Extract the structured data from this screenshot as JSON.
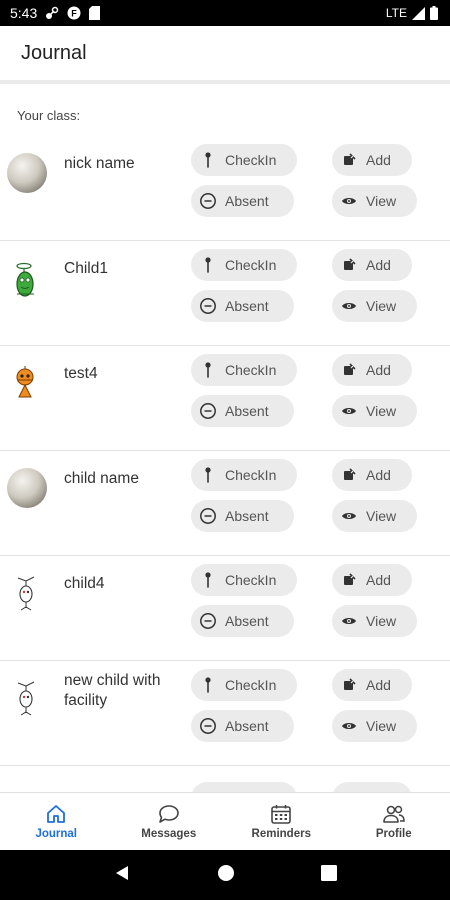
{
  "status_bar": {
    "time": "5:43",
    "network": "LTE"
  },
  "app_bar": {
    "title": "Journal"
  },
  "section": {
    "label": "Your class:"
  },
  "actions": {
    "checkin": "CheckIn",
    "absent": "Absent",
    "add": "Add",
    "view": "View"
  },
  "children": [
    {
      "name": "nick name",
      "avatar": "sphere-avatar"
    },
    {
      "name": "Child1",
      "avatar": "green-doodle-avatar"
    },
    {
      "name": "test4",
      "avatar": "orange-doodle-avatar"
    },
    {
      "name": "child name",
      "avatar": "sphere-avatar"
    },
    {
      "name": "child4",
      "avatar": "sketch-doodle-avatar"
    },
    {
      "name": "new child with facility",
      "avatar": "sketch-doodle-avatar"
    }
  ],
  "bottom_nav": [
    {
      "label": "Journal",
      "icon": "home-icon",
      "active": true
    },
    {
      "label": "Messages",
      "icon": "chat-bubble-icon",
      "active": false
    },
    {
      "label": "Reminders",
      "icon": "calendar-icon",
      "active": false
    },
    {
      "label": "Profile",
      "icon": "people-icon",
      "active": false
    }
  ],
  "colors": {
    "accent": "#1e6fd9",
    "pill_bg": "#ebebeb",
    "status_bar": "#000000"
  }
}
